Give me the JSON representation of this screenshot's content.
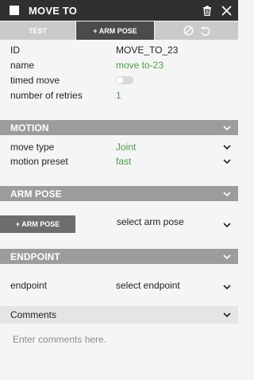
{
  "window": {
    "title": "MOVE TO"
  },
  "toolbar": {
    "test_label": "TEST",
    "arm_pose_label": "+ ARM POSE"
  },
  "properties": {
    "id_label": "ID",
    "id_value": "MOVE_TO_23",
    "name_label": "name",
    "name_value": "move to-23",
    "timed_move_label": "timed move",
    "timed_move_on": false,
    "retries_label": "number of retries",
    "retries_value": "1"
  },
  "motion": {
    "header": "MOTION",
    "move_type_label": "move type",
    "move_type_value": "Joint",
    "preset_label": "motion preset",
    "preset_value": "fast"
  },
  "arm_pose": {
    "header": "ARM POSE",
    "button_label": "+ ARM POSE",
    "select_placeholder": "select arm pose"
  },
  "endpoint": {
    "header": "ENDPOINT",
    "label": "endpoint",
    "select_placeholder": "select endpoint"
  },
  "comments": {
    "header": "Comments",
    "placeholder": "Enter comments here."
  },
  "colors": {
    "titlebar": "#303030",
    "section_header": "#9c9c9c",
    "accent_green": "#4b9c47",
    "toolbar_light": "#c8cacb",
    "toolbar_dark": "#4b4b4b"
  },
  "icons": [
    "trash-icon",
    "close-icon",
    "disable-icon",
    "undo-icon",
    "chevron-down-icon",
    "chevron-up-icon"
  ]
}
